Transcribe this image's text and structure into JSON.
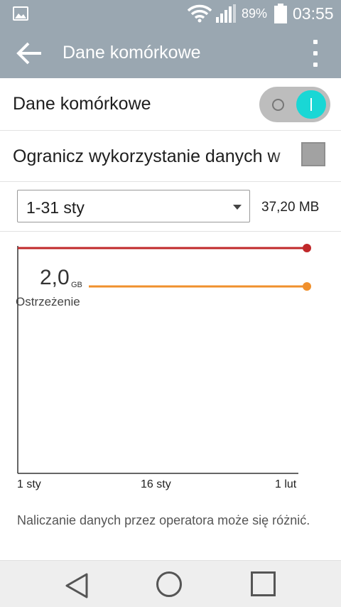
{
  "status_bar": {
    "battery_percent": "89%",
    "time": "03:55",
    "icons": [
      "gallery-icon",
      "wifi-icon",
      "signal-icon",
      "battery-icon"
    ]
  },
  "app_bar": {
    "title": "Dane komórkowe",
    "back_icon": "arrow-left-icon",
    "menu_icon": "more-vert-icon"
  },
  "mobile_data": {
    "label": "Dane komórkowe",
    "enabled": true
  },
  "limit_data": {
    "label": "Ogranicz wykorzystanie danych w",
    "checked": false
  },
  "period": {
    "selected": "1-31 sty",
    "usage": "37,20 MB"
  },
  "chart": {
    "warning_value": "2,0",
    "warning_unit": "GB",
    "warning_label": "Ostrzeżenie",
    "x_labels": [
      "1 sty",
      "16 sty",
      "1 lut"
    ],
    "colors": {
      "limit_line": "#c0282a",
      "warning_line": "#f0902c",
      "axis": "#333333"
    }
  },
  "note": "Naliczanie danych przez operatora może się różnić.",
  "nav_bar": {
    "icons": [
      "back-triangle-icon",
      "home-circle-icon",
      "recents-square-icon"
    ]
  }
}
